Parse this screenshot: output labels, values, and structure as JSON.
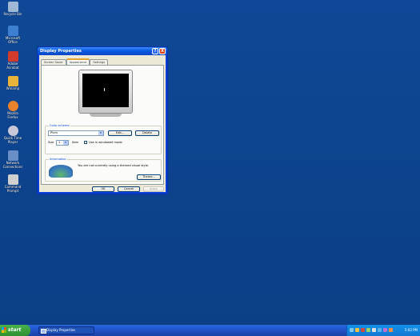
{
  "desktop": {
    "icons": [
      {
        "label": "Recycle Bin",
        "color": "#9fb8d6"
      },
      {
        "label": "Microsoft Office",
        "color": "#3f7fd1"
      },
      {
        "label": "Adobe Acrobat",
        "color": "#d23a2c"
      },
      {
        "label": "Winamp",
        "color": "#e8b43a"
      },
      {
        "label": "Mozilla Firefox",
        "color": "#e8822c"
      },
      {
        "label": "Quick Time Player",
        "color": "#c8c8d8"
      },
      {
        "label": "Network Connections",
        "color": "#6a8fc8"
      },
      {
        "label": "Command Prompt",
        "color": "#d0d0d0"
      }
    ]
  },
  "dialog": {
    "title": "Display Properties",
    "help_button": "?",
    "close_button": "X",
    "tabs": [
      {
        "label": "Screen Saver"
      },
      {
        "label": "Appearance"
      },
      {
        "label": "Settings"
      }
    ],
    "color_scheme_group": "Color scheme",
    "color_scheme_value": "Plum",
    "edit_label": "Edit...",
    "delete_label": "Delete",
    "size_label": "Size",
    "size_value": "1",
    "item_label": "Item",
    "checkbox_label": "Use in windowed mode",
    "info_group": "Information",
    "info_text": "You are not currently using a themed visual style.",
    "theme_label": "Theme...",
    "ok_label": "OK",
    "cancel_label": "Cancel",
    "apply_label": "Apply"
  },
  "taskbar": {
    "start_label": "start",
    "task_label": "Display Properties",
    "clock": "5:02 PM"
  },
  "colors": {
    "desktop": "#0e4896",
    "title_bar": "#0a5ae0",
    "start_button": "#2f8f31",
    "tray": "#1290e8"
  }
}
